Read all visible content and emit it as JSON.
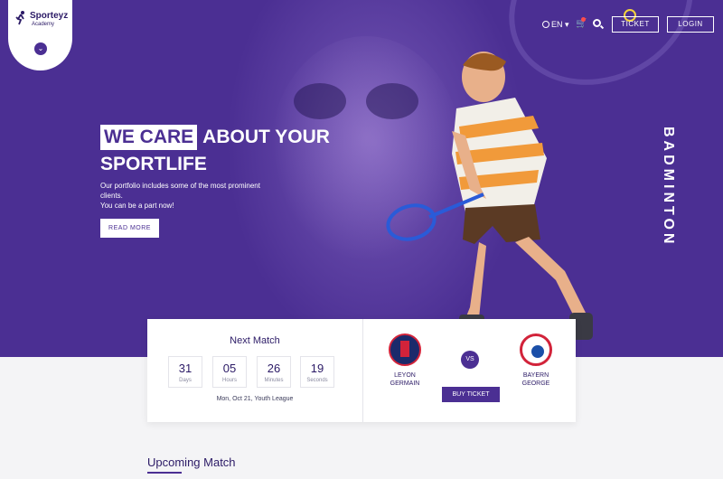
{
  "brand": {
    "name": "Sporteyz",
    "subtitle": "Academy"
  },
  "nav": {
    "language": "EN",
    "ticket_label": "TICKET",
    "login_label": "LOGIN"
  },
  "hero": {
    "headline_highlight": "WE CARE",
    "headline_rest": "ABOUT YOUR",
    "headline_line2": "SPORTLIFE",
    "description_line1": "Our portfolio includes some of the most prominent clients.",
    "description_line2": "You can be a part now!",
    "read_more_label": "READ MORE",
    "vertical_text": "BADMINTON"
  },
  "next_match": {
    "title": "Next Match",
    "countdown": [
      {
        "value": "31",
        "label": "Days"
      },
      {
        "value": "05",
        "label": "Hours"
      },
      {
        "value": "26",
        "label": "Minutes"
      },
      {
        "value": "19",
        "label": "Seconds"
      }
    ],
    "date": "Mon, Oct 21, Youth League",
    "home_team_line1": "LEYON",
    "home_team_line2": "GERMAIN",
    "vs_label": "VS",
    "away_team_line1": "BAYERN",
    "away_team_line2": "GEORGE",
    "buy_ticket_label": "BUY TICKET"
  },
  "upcoming": {
    "title": "Upcoming Match"
  },
  "colors": {
    "primary": "#4b2f93",
    "dark": "#2b1a66",
    "accent": "#f3d23c"
  }
}
